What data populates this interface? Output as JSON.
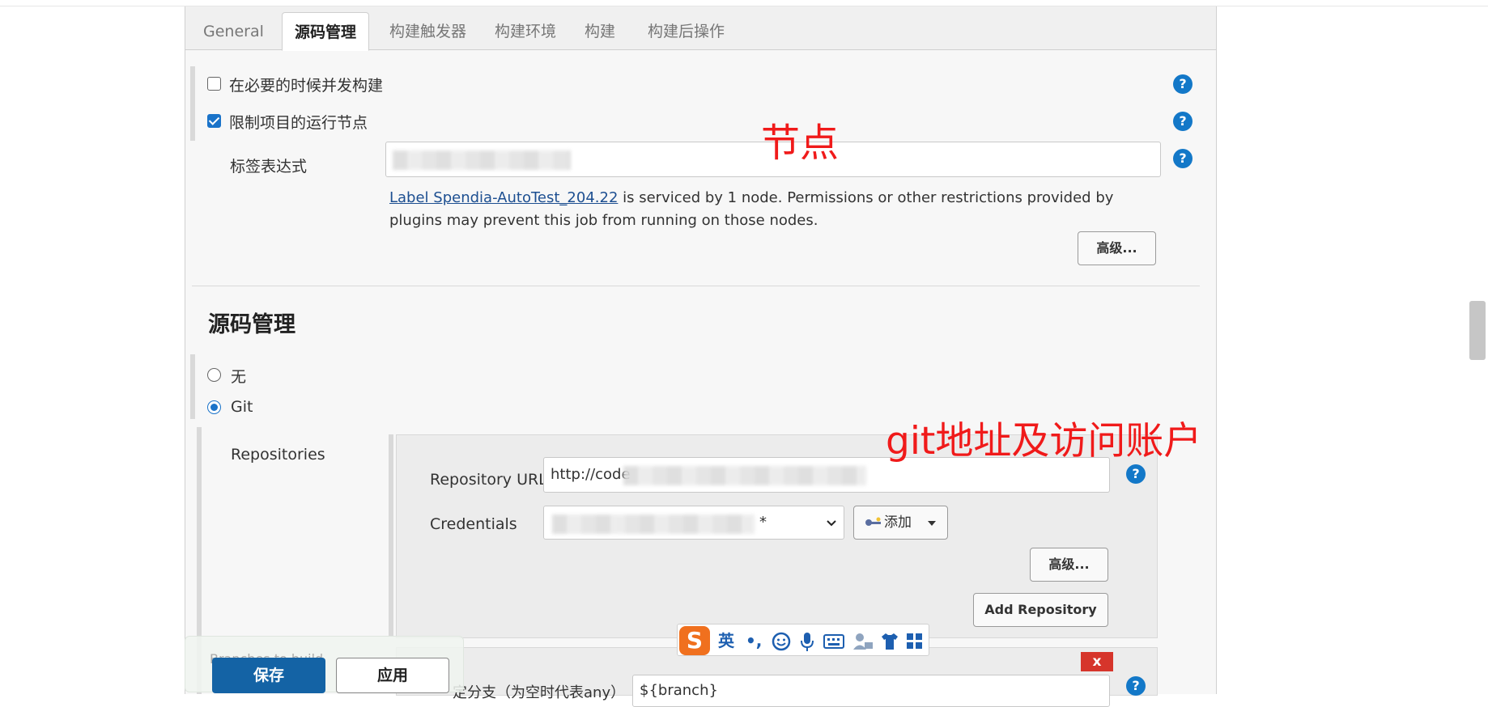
{
  "tabs": [
    "General",
    "源码管理",
    "构建触发器",
    "构建环境",
    "构建",
    "构建后操作"
  ],
  "options": {
    "concurrent_label": "在必要的时候并发构建",
    "restrict_label": "限制项目的运行节点",
    "label_expr_label": "标签表达式",
    "label_link": "Label Spendia-AutoTest_204.22",
    "label_desc_rest": " is serviced by 1 node. Permissions or other restrictions provided by plugins may prevent this job from running on those nodes.",
    "advanced_label": "高级..."
  },
  "annotations": {
    "node": "节点",
    "git": "git地址及访问账户"
  },
  "scm": {
    "title": "源码管理",
    "none_label": "无",
    "git_label": "Git",
    "repositories_label": "Repositories",
    "repo_url_label": "Repository URL",
    "repo_url_value": "http://code",
    "credentials_label": "Credentials",
    "credentials_value": "*",
    "add_label": "添加",
    "advanced_label": "高级...",
    "add_repo_label": "Add Repository",
    "branch_label": "定分支（为空时代表any）",
    "branch_value": "${branch}",
    "obscured_label": "Branches to build"
  },
  "footer": {
    "save_label": "保存",
    "apply_label": "应用"
  },
  "ime": {
    "logo": "S",
    "lang": "英",
    "punct": "•,",
    "close": "x"
  },
  "help_glyph": "?"
}
